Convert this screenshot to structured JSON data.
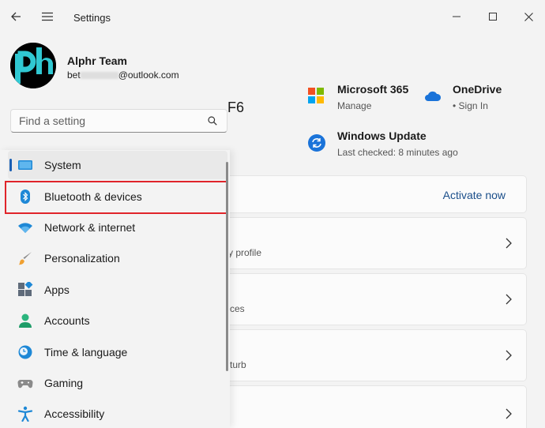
{
  "window": {
    "title": "Settings"
  },
  "profile": {
    "avatar_text": "ph",
    "name": "Alphr Team",
    "email_prefix": "bet",
    "email_domain": "@outlook.com"
  },
  "search": {
    "placeholder": "Find a setting"
  },
  "sidebar": {
    "items": [
      {
        "label": "System",
        "icon": "system-icon"
      },
      {
        "label": "Bluetooth & devices",
        "icon": "bluetooth-icon"
      },
      {
        "label": "Network & internet",
        "icon": "wifi-icon"
      },
      {
        "label": "Personalization",
        "icon": "brush-icon"
      },
      {
        "label": "Apps",
        "icon": "apps-icon"
      },
      {
        "label": "Accounts",
        "icon": "person-icon"
      },
      {
        "label": "Time & language",
        "icon": "clock-globe-icon"
      },
      {
        "label": "Gaming",
        "icon": "gamepad-icon"
      },
      {
        "label": "Accessibility",
        "icon": "accessibility-icon"
      }
    ]
  },
  "main": {
    "device_name_fragment": "F6",
    "tiles": {
      "m365": {
        "title": "Microsoft 365",
        "subtitle": "Manage"
      },
      "onedrive": {
        "title": "OneDrive",
        "subtitle": "• Sign In"
      },
      "update": {
        "title": "Windows Update",
        "subtitle": "Last checked: 8 minutes ago"
      }
    },
    "activate": {
      "label": "Activate now"
    },
    "cards": [
      {
        "fragment": "y profile"
      },
      {
        "fragment": "ces"
      },
      {
        "fragment": "turb"
      },
      {
        "fragment": ""
      }
    ]
  },
  "colors": {
    "accent": "#1a5fb4",
    "highlight": "#e0242a",
    "link": "#1a4e8a"
  }
}
